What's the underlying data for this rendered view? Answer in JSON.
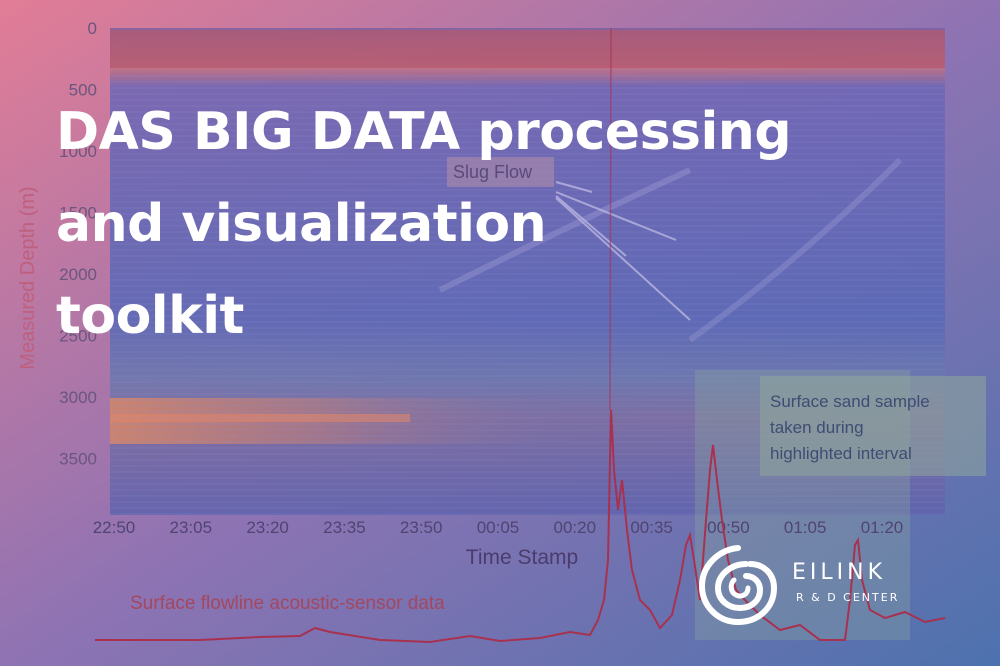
{
  "headline": {
    "line1": "DAS BIG DATA processing",
    "line2": "and visualization",
    "line3": "toolkit"
  },
  "plot": {
    "y_axis_label": "Measured Depth (m)",
    "y_ticks": [
      "0",
      "500",
      "1000",
      "1500",
      "2000",
      "2500",
      "3000",
      "3500"
    ],
    "x_axis_label": "Time Stamp",
    "x_ticks": [
      "22:50",
      "23:05",
      "23:20",
      "23:35",
      "23:50",
      "00:05",
      "00:20",
      "00:35",
      "00:50",
      "01:05",
      "01:20"
    ],
    "annotation_slug": "Slug Flow",
    "annotation_sand_1": "Surface sand sample",
    "annotation_sand_2": "taken during",
    "annotation_sand_3": "highlighted interval",
    "flowline_label": "Surface flowline acoustic-sensor data"
  },
  "logo": {
    "name": "EILINK",
    "subtitle": "R & D CENTER",
    "icon": "eilink-swirl-icon"
  },
  "colors": {
    "gradient_left": "#e07a96",
    "gradient_mid": "#7e70b8",
    "gradient_right": "#4f6fae",
    "heatmap_base": "#4a5fb0",
    "heatmap_warm": "#d6705f",
    "trace": "#b0304a",
    "text": "#ffffff"
  }
}
